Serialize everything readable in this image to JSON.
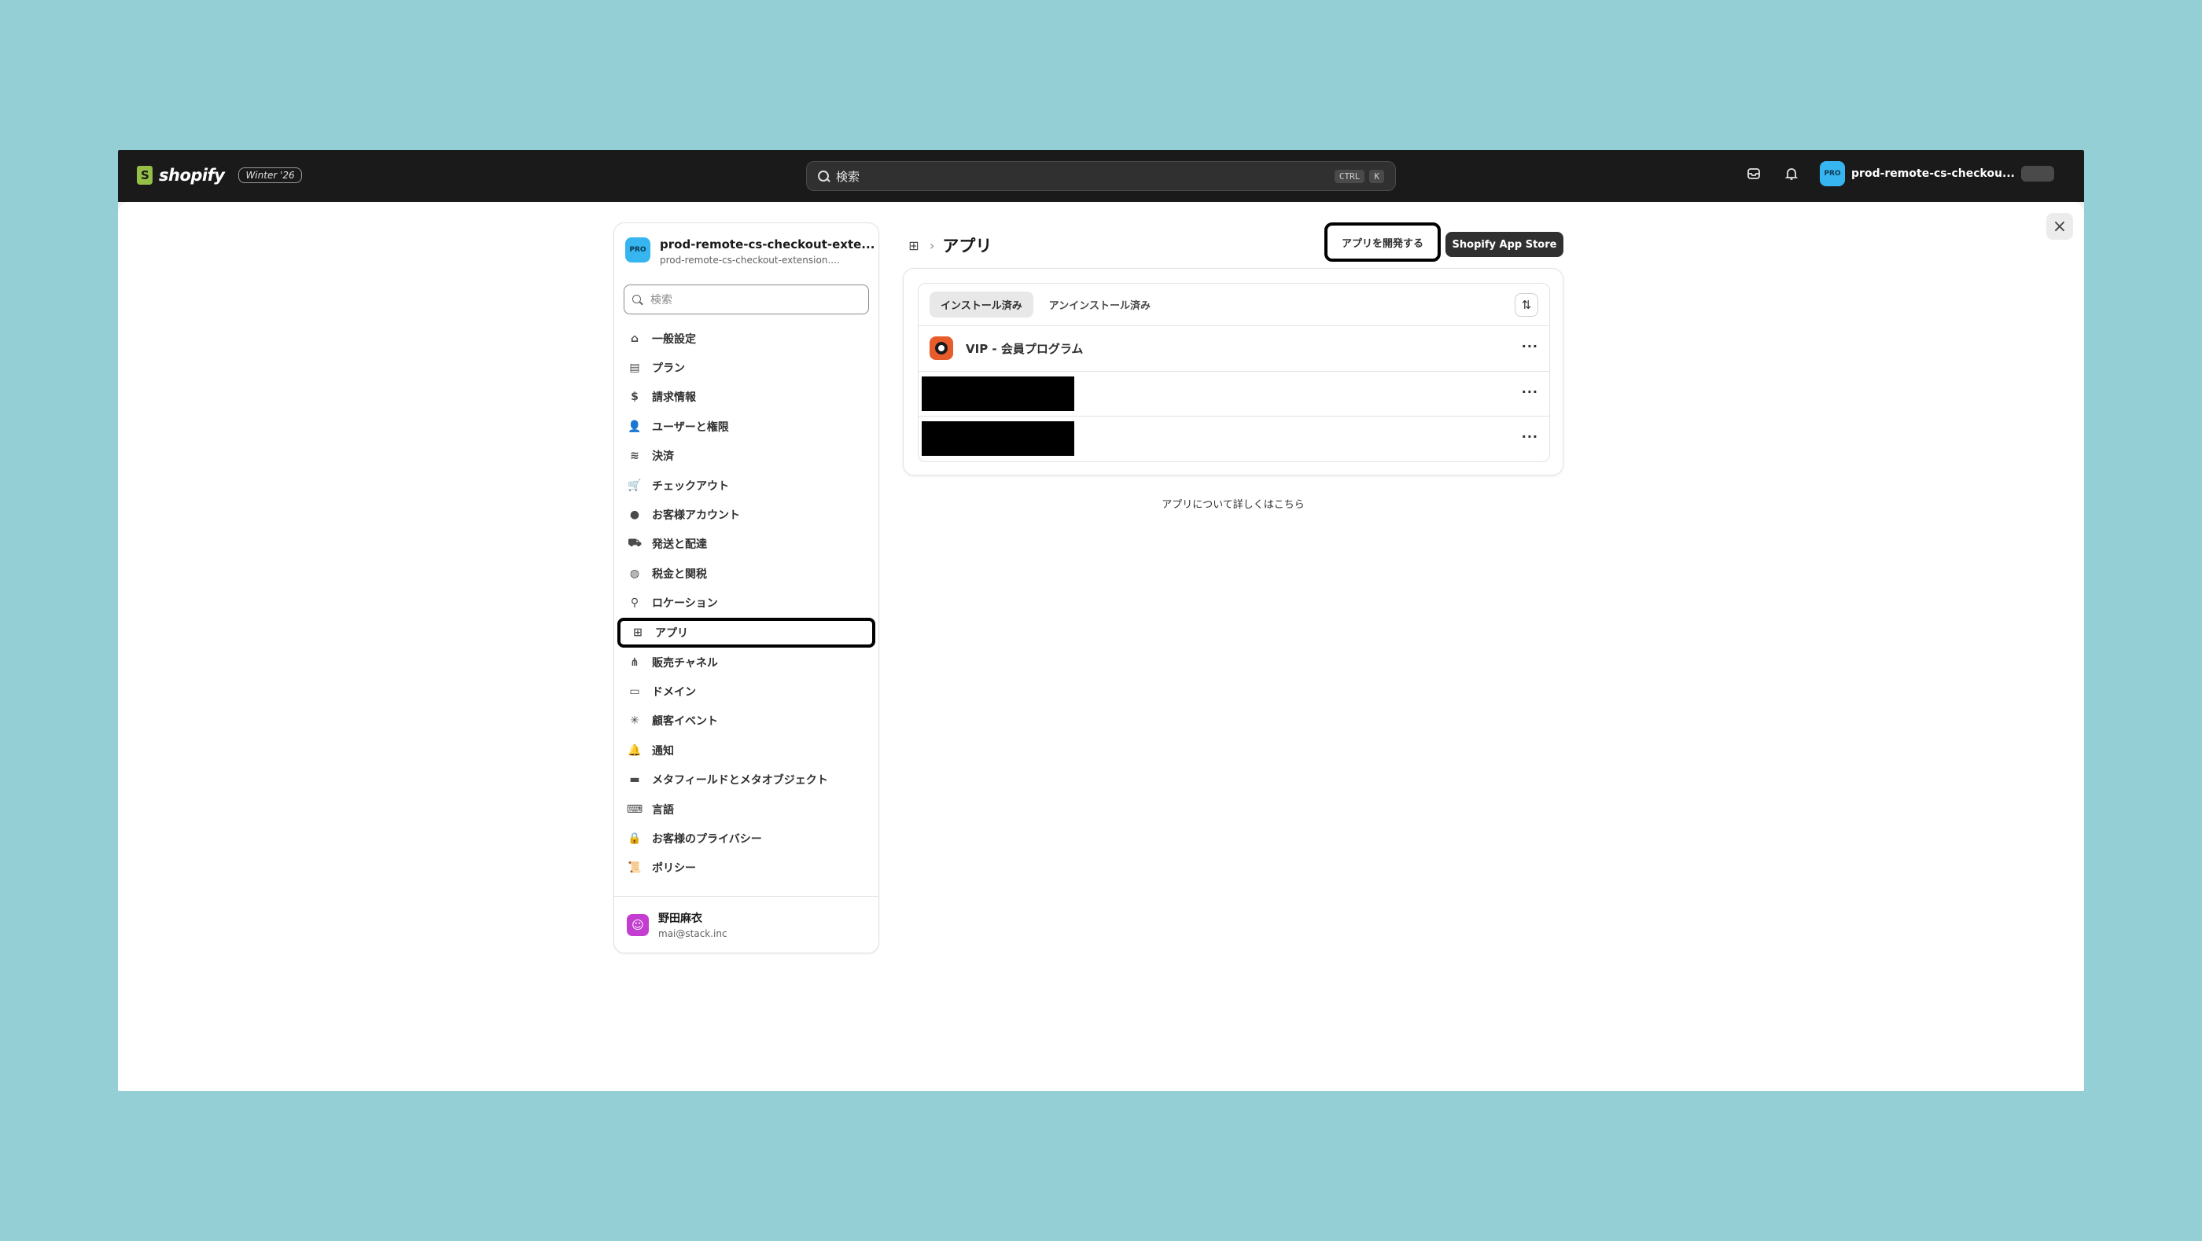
{
  "topbar": {
    "brand": "shopify",
    "edition": "Winter '26",
    "search_placeholder": "検索",
    "kbd": [
      "CTRL",
      "K"
    ],
    "store_avatar": "PRO",
    "store_name": "prod-remote-cs-checkou..."
  },
  "nav": {
    "store_title": "prod-remote-cs-checkout-exte...",
    "store_domain": "prod-remote-cs-checkout-extension....",
    "store_avatar": "PRO",
    "search_placeholder": "検索",
    "items": [
      {
        "label": "一般設定",
        "icon": "store-icon"
      },
      {
        "label": "プラン",
        "icon": "plan-icon"
      },
      {
        "label": "請求情報",
        "icon": "billing-icon"
      },
      {
        "label": "ユーザーと権限",
        "icon": "users-icon"
      },
      {
        "label": "決済",
        "icon": "payments-icon"
      },
      {
        "label": "チェックアウト",
        "icon": "cart-icon"
      },
      {
        "label": "お客様アカウント",
        "icon": "person-icon"
      },
      {
        "label": "発送と配達",
        "icon": "truck-icon"
      },
      {
        "label": "税金と関税",
        "icon": "tax-icon"
      },
      {
        "label": "ロケーション",
        "icon": "location-icon"
      },
      {
        "label": "アプリ",
        "icon": "apps-icon",
        "active": true
      },
      {
        "label": "販売チャネル",
        "icon": "channels-icon"
      },
      {
        "label": "ドメイン",
        "icon": "domain-icon"
      },
      {
        "label": "顧客イベント",
        "icon": "events-icon"
      },
      {
        "label": "通知",
        "icon": "bell-icon"
      },
      {
        "label": "メタフィールドとメタオブジェクト",
        "icon": "metafields-icon"
      },
      {
        "label": "言語",
        "icon": "language-icon"
      },
      {
        "label": "お客様のプライバシー",
        "icon": "lock-icon"
      },
      {
        "label": "ポリシー",
        "icon": "policy-icon"
      }
    ],
    "user": {
      "name": "野田麻衣",
      "email": "mai@stack.inc"
    }
  },
  "main": {
    "title": "アプリ",
    "develop_button": "アプリを開発する",
    "store_button": "Shopify App Store",
    "tabs": [
      "インストール済み",
      "アンインストール済み"
    ],
    "apps": [
      {
        "name": "VIP - 会員プログラム",
        "redacted": false
      },
      {
        "name": "",
        "redacted": true
      },
      {
        "name": "",
        "redacted": true
      }
    ],
    "more_label": "···",
    "learn_more": "アプリについて詳しくはこちら"
  }
}
